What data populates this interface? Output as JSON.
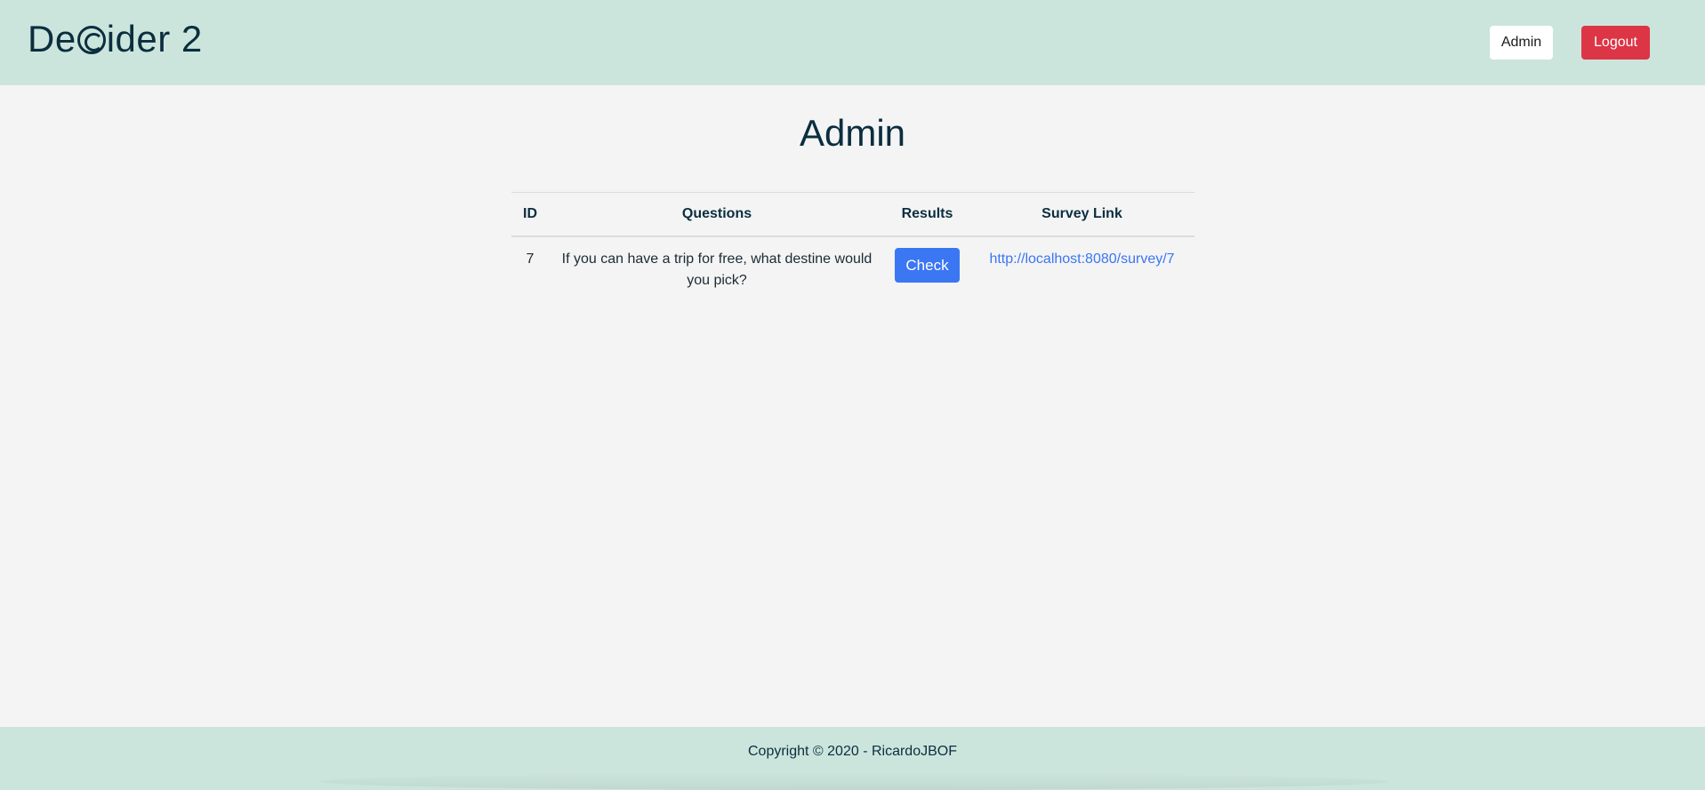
{
  "header": {
    "brand_prefix": "De",
    "brand_suffix": "ider 2",
    "brand_icon": "copyright-circle-icon",
    "admin_label": "Admin",
    "logout_label": "Logout"
  },
  "main": {
    "title": "Admin",
    "table": {
      "columns": [
        "ID",
        "Questions",
        "Results",
        "Survey Link"
      ],
      "rows": [
        {
          "id": "7",
          "question": "If you can have a trip for free, what destine would you pick?",
          "result_button": "Check",
          "survey_link": "http://localhost:8080/survey/7"
        }
      ]
    }
  },
  "footer": {
    "copyright": "Copyright © 2020 - RicardoJBOF"
  },
  "colors": {
    "header_bg": "#cce5dc",
    "page_bg": "#f4f4f4",
    "text_dark": "#0b2e3f",
    "primary": "#3b76f3",
    "danger": "#dc3546"
  }
}
